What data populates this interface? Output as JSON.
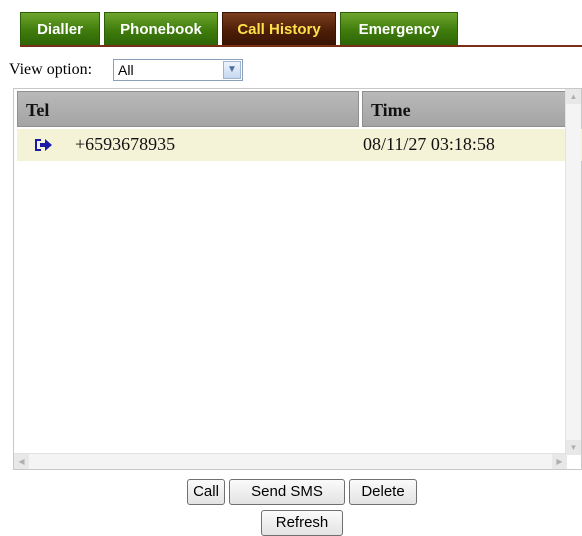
{
  "tabs": [
    {
      "label": "Dialler",
      "active": false
    },
    {
      "label": "Phonebook",
      "active": false
    },
    {
      "label": "Call History",
      "active": true
    },
    {
      "label": "Emergency",
      "active": false
    }
  ],
  "view_option": {
    "label": "View option:",
    "selected": "All"
  },
  "table": {
    "columns": [
      "Tel",
      "Time"
    ],
    "rows": [
      {
        "icon": "outgoing-call-arrow-icon",
        "tel": "+6593678935",
        "time": "08/11/27 03:18:58"
      }
    ]
  },
  "buttons": {
    "call": "Call",
    "send_sms": "Send SMS",
    "delete": "Delete",
    "refresh": "Refresh"
  },
  "colors": {
    "tab_green": "#3f7c0c",
    "tab_active": "#4d1e08",
    "active_tab_text": "#ffe04a",
    "row_highlight": "#f4f3d8",
    "call_icon": "#1a1aa6"
  }
}
